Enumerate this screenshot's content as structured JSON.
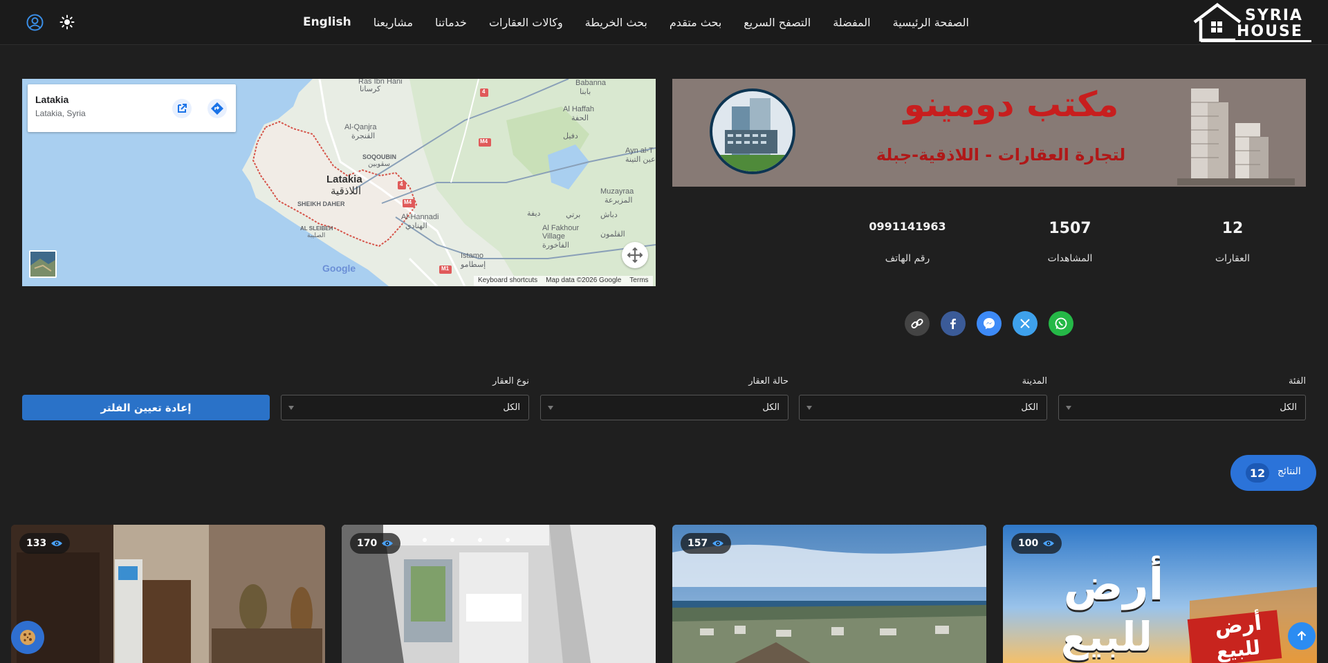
{
  "nav": {
    "links": [
      "الصفحة الرئيسية",
      "المفضلة",
      "التصفح السريع",
      "بحث متقدم",
      "بحث الخريطة",
      "وكالات العقارات",
      "خدماتنا",
      "مشاريعنا",
      "English"
    ],
    "logo_line1": "SYRIA",
    "logo_line2": "HOUSE",
    "user_icon": "user-circle-icon",
    "theme_icon": "sun-icon"
  },
  "map": {
    "place_name": "Latakia",
    "place_sub": "Latakia, Syria",
    "labels": {
      "ras_ibn_hani": "Ras Ibn Hani",
      "kirsana": "كرسانا",
      "babanna": "Babanna",
      "babanna_ar": "بابنا",
      "haffah": "Al Haffah",
      "haffah_ar": "الحفة",
      "daqil": "دفيل",
      "qanjra": "Al-Qanjra",
      "qanjra_ar": "القنجرة",
      "ayn_al": "Ayn al-T",
      "ayn_al_ar": "عين التينة",
      "soqubin": "SOQOUBIN",
      "soqubin_ar": "سقوبين",
      "latakia": "Latakia",
      "latakia_ar": "اللاذقية",
      "sheikh": "SHEIKH DAHER",
      "muzayraa": "Muzayraa",
      "muzayraa_ar": "المزيرعة",
      "hannadi": "Al-Hannadi",
      "hannadi_ar": "الهنادي",
      "dabash": "دباش",
      "barti": "برتي",
      "dafna": "ديفة",
      "fakhour": "Al Fakhour",
      "fakhour2": "Village",
      "fakhour_ar": "الفاخورة",
      "qalamoun": "القلمون",
      "sleibeh": "AL SLEIBEH",
      "sleibeh_ar": "الصليبة",
      "istamo": "Istamo",
      "istamo_ar": "إسطامو",
      "m4a": "M4",
      "m4b": "M4",
      "r4a": "4",
      "r4b": "4",
      "m1": "M1"
    },
    "google": "Google",
    "attribution": [
      "Keyboard shortcuts",
      "Map data ©2026 Google",
      "Terms"
    ]
  },
  "banner": {
    "title": "مكتب دومينو",
    "subtitle": "لتجارة العقارات - اللاذقية-جبلة"
  },
  "stats": {
    "properties_value": "12",
    "properties_label": "العقارات",
    "views_value": "1507",
    "views_label": "المشاهدات",
    "phone_value": "0991141963",
    "phone_label": "رقم الهاتف"
  },
  "share": [
    "whatsapp-icon",
    "x-icon",
    "messenger-icon",
    "facebook-icon",
    "link-icon"
  ],
  "filters": {
    "category_label": "الفئة",
    "category_value": "الكل",
    "city_label": "المدينة",
    "city_value": "الكل",
    "status_label": "حالة العقار",
    "status_value": "الكل",
    "type_label": "نوع العقار",
    "type_value": "الكل",
    "reset_label": "إعادة تعيين الفلتر"
  },
  "results": {
    "count": "12",
    "label": "النتائج"
  },
  "cards": [
    {
      "views": "133"
    },
    {
      "views": "170"
    },
    {
      "views": "157"
    },
    {
      "views": "100",
      "overlay_text_1": "أرض",
      "overlay_text_2": "للبيع",
      "sign_1": "أرض",
      "sign_2": "للبيع"
    }
  ],
  "colors": {
    "background": "#1f1f1f",
    "accent": "#2a72c8",
    "whatsapp": "#25b847",
    "x": "#3ea1ec",
    "messenger": "#3d8af7",
    "facebook": "#3b5b98",
    "link": "#444444"
  }
}
